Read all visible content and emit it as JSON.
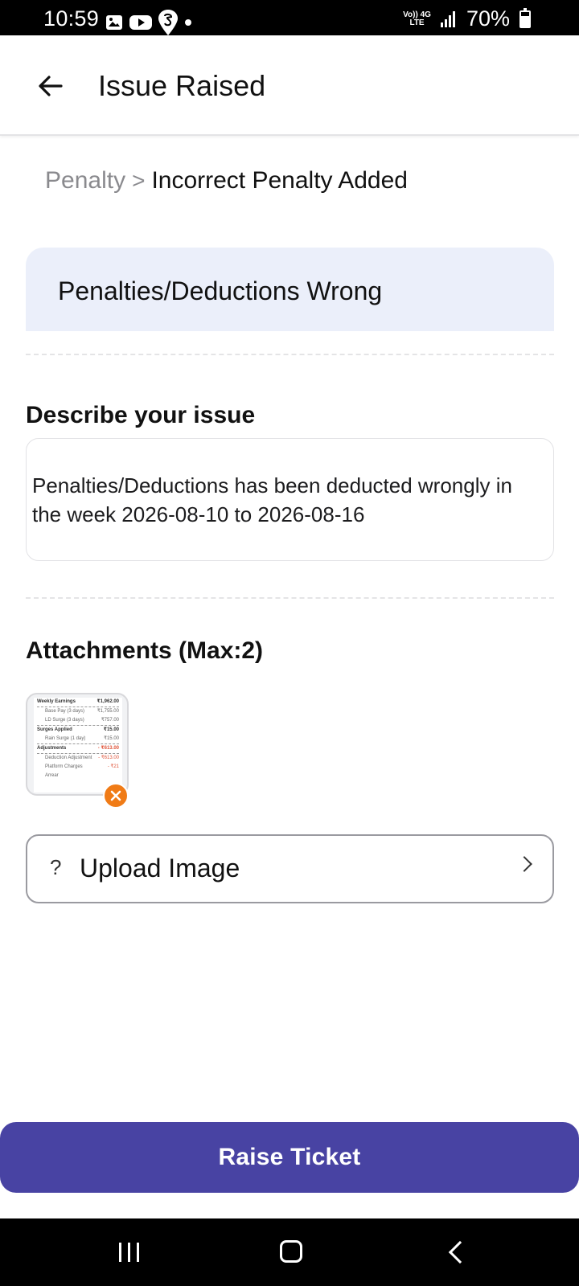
{
  "status_bar": {
    "time": "10:59",
    "network_top": "Vo)) 4G",
    "network_bottom": "LTE",
    "battery": "70%"
  },
  "header": {
    "title": "Issue Raised"
  },
  "breadcrumb": {
    "parent": "Penalty",
    "separator": ">",
    "current": "Incorrect Penalty Added"
  },
  "category": {
    "title": "Penalties/Deductions Wrong"
  },
  "description": {
    "label": "Describe your issue",
    "value": "Penalties/Deductions has been deducted wrongly in the week 2026-08-10 to 2026-08-16"
  },
  "attachments": {
    "label": "Attachments (Max:2)",
    "thumbnail_rows": [
      {
        "label": "Weekly Earnings",
        "value": "₹1,962.00"
      },
      {
        "label": "Base Pay (3 days)",
        "value": "₹1,755.00"
      },
      {
        "label": "LD Surge (3 days)",
        "value": "₹757.00"
      },
      {
        "label": "Surges Applied",
        "value": "₹15.00"
      },
      {
        "label": "Rain Surge (1 day)",
        "value": "₹15.00"
      },
      {
        "label": "Adjustments",
        "value": "- ₹613.00"
      },
      {
        "label": "Deduction Adjustment",
        "value": "- ₹613.00"
      },
      {
        "label": "Platform Charges",
        "value": "- ₹21"
      },
      {
        "label": "Arrear",
        "value": ""
      }
    ]
  },
  "upload": {
    "icon": "?",
    "label": "Upload Image"
  },
  "actions": {
    "raise_ticket": "Raise Ticket"
  },
  "colors": {
    "primary": "#4843a3",
    "card_bg": "#ebeffa",
    "remove_badge": "#f07b16"
  }
}
